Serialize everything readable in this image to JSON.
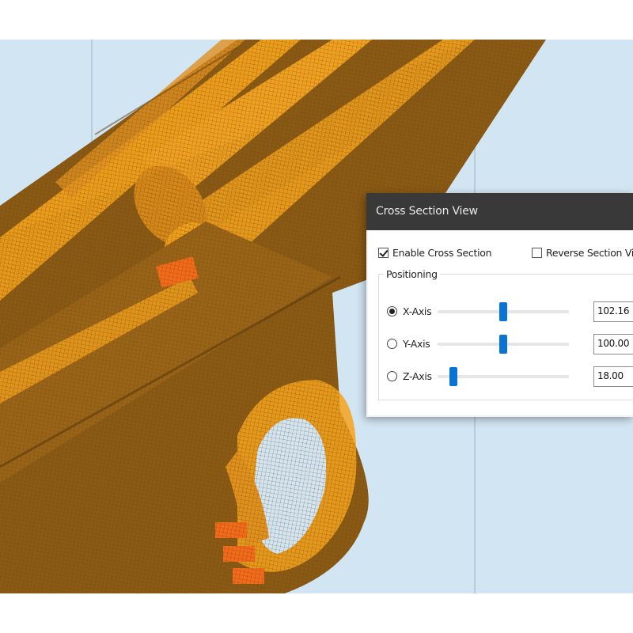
{
  "dialog": {
    "title": "Cross Section View",
    "enable_cross_section": {
      "label": "Enable Cross Section",
      "checked": true
    },
    "reverse_section_view": {
      "label": "Reverse Section View",
      "checked": false
    },
    "positioning": {
      "title": "Positioning",
      "axes": [
        {
          "label": "X-Axis",
          "selected": true,
          "value": "102.16",
          "slider_fraction": 0.5
        },
        {
          "label": "Y-Axis",
          "selected": false,
          "value": "100.00",
          "slider_fraction": 0.5
        },
        {
          "label": "Z-Axis",
          "selected": false,
          "value": "18.00",
          "slider_fraction": 0.12
        }
      ]
    }
  },
  "colors": {
    "viewport_background": "#d2e5f3",
    "model_body": "#8a5a15",
    "model_highlight": "#f5a31c",
    "model_accent": "#f26a1a",
    "slider_thumb": "#0a74d4",
    "dialog_titlebar": "#393939"
  }
}
